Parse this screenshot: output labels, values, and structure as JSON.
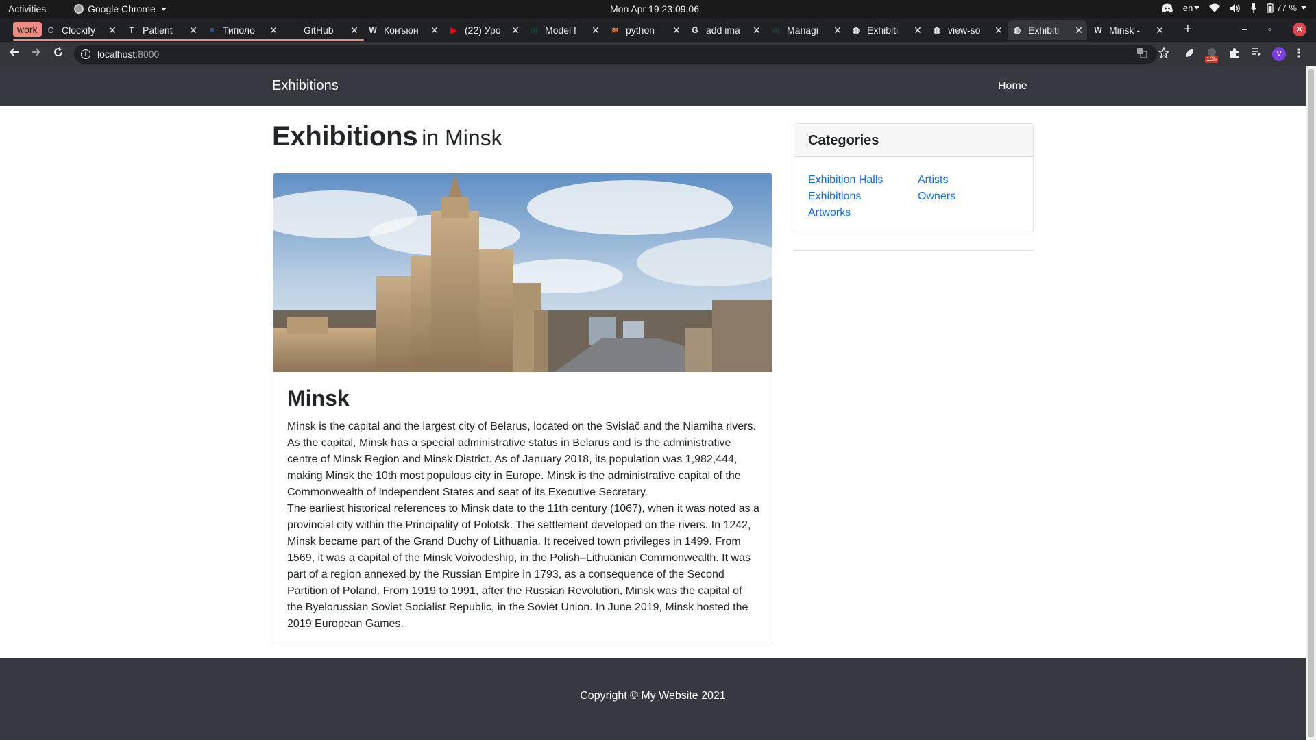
{
  "os_bar": {
    "activities": "Activities",
    "app_name": "Google Chrome",
    "clock": "Mon Apr 19  23:09:06",
    "lang": "en",
    "battery": "77 %"
  },
  "browser": {
    "tab_group_label": "work",
    "tabs": [
      {
        "label": "Clockify",
        "favicon": "C",
        "fav_color": "#9aa0a6"
      },
      {
        "label": "Patient",
        "favicon": "T",
        "fav_color": "#e8eaed"
      },
      {
        "label": "Типоло",
        "favicon": "≡",
        "fav_color": "#4285f4"
      },
      {
        "label": "GitHub",
        "favicon": "",
        "fav_color": "#202124"
      },
      {
        "label": "Конъюн",
        "favicon": "W",
        "fav_color": "#e8eaed"
      },
      {
        "label": "(22) Уро",
        "favicon": "▶",
        "fav_color": "#ff0000"
      },
      {
        "label": "Model f",
        "favicon": "dj",
        "fav_color": "#0c4b33"
      },
      {
        "label": "python",
        "favicon": "≋",
        "fav_color": "#f48024"
      },
      {
        "label": "add ima",
        "favicon": "G",
        "fav_color": "#e8eaed"
      },
      {
        "label": "Managi",
        "favicon": "dj",
        "fav_color": "#0c4b33"
      },
      {
        "label": "Exhibiti",
        "favicon": "◍",
        "fav_color": "#e8eaed"
      },
      {
        "label": "view-so",
        "favicon": "◍",
        "fav_color": "#e8eaed"
      },
      {
        "label": "Exhibiti",
        "favicon": "◍",
        "fav_color": "#e8eaed",
        "active": true
      },
      {
        "label": "Minsk -",
        "favicon": "W",
        "fav_color": "#e8eaed"
      }
    ],
    "url_host": "localhost",
    "url_port": ":8000",
    "ext_badge": "10h",
    "profile_initial": "V"
  },
  "site": {
    "brand": "Exhibitions",
    "nav_home": "Home",
    "heading_main": "Exhibitions",
    "heading_sub": "in Minsk",
    "city_title": "Minsk",
    "paragraphs": [
      "Minsk is the capital and the largest city of Belarus, located on the Svislač and the Niamiha rivers. As the capital, Minsk has a special administrative status in Belarus and is the administrative centre of Minsk Region and Minsk District. As of January 2018, its population was 1,982,444, making Minsk the 10th most populous city in Europe. Minsk is the administrative capital of the Commonwealth of Independent States and seat of its Executive Secretary.",
      "The earliest historical references to Minsk date to the 11th century (1067), when it was noted as a provincial city within the Principality of Polotsk. The settlement developed on the rivers. In 1242, Minsk became part of the Grand Duchy of Lithuania. It received town privileges in 1499. From 1569, it was a capital of the Minsk Voivodeship, in the Polish–Lithuanian Commonwealth. It was part of a region annexed by the Russian Empire in 1793, as a consequence of the Second Partition of Poland. From 1919 to 1991, after the Russian Revolution, Minsk was the capital of the Byelorussian Soviet Socialist Republic, in the Soviet Union. In June 2019, Minsk hosted the 2019 European Games."
    ],
    "categories_title": "Categories",
    "categories_left": [
      "Exhibition Halls",
      "Exhibitions",
      "Artworks"
    ],
    "categories_right": [
      "Artists",
      "Owners"
    ],
    "footer": "Copyright © My Website 2021",
    "colors": {
      "navbar": "#343a40",
      "link": "#0d6efd",
      "text": "#212529"
    }
  }
}
